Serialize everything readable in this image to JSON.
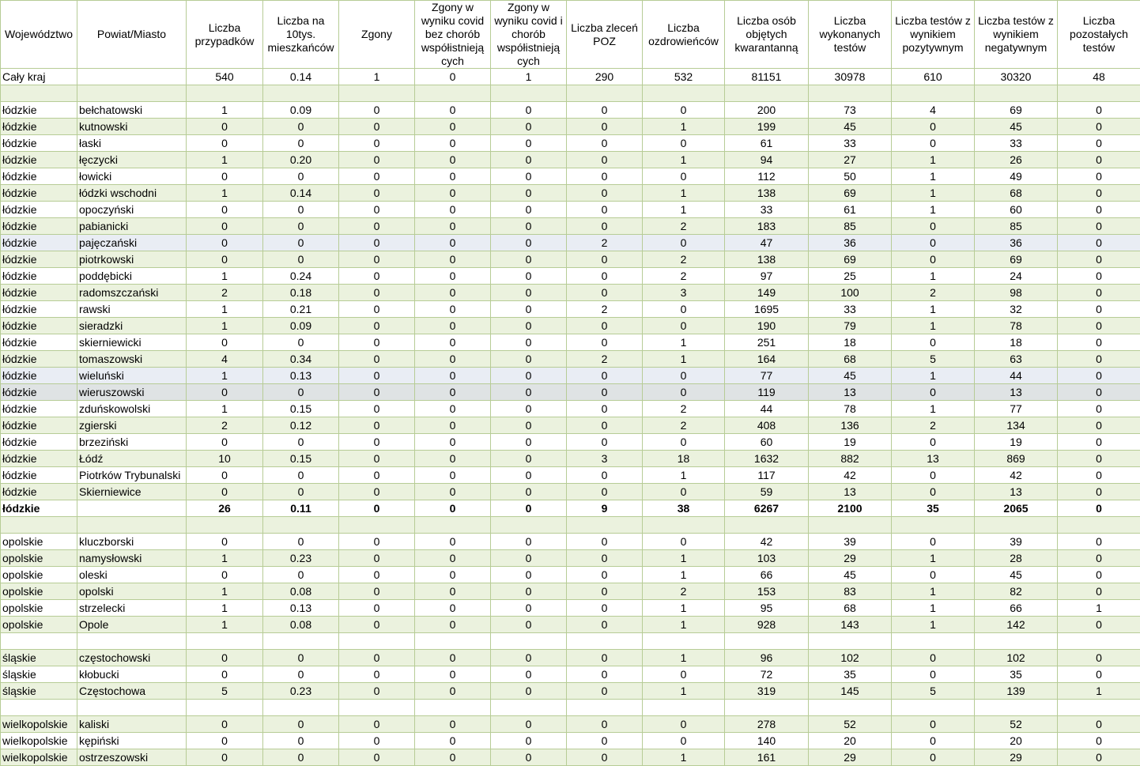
{
  "columns": [
    "Województwo",
    "Powiat/Miasto",
    "Liczba przypadków",
    "Liczba na 10tys. mieszkańców",
    "Zgony",
    "Zgony w wyniku covid bez chorób współistnieją cych",
    "Zgony w wyniku covid i chorób współistnieją cych",
    "Liczba zleceń POZ",
    "Liczba ozdrowieńców",
    "Liczba osób objętych kwarantanną",
    "Liczba wykonanych testów",
    "Liczba testów z wynikiem pozytywnym",
    "Liczba testów z wynikiem negatywnym",
    "Liczba pozostałych testów"
  ],
  "rows": [
    {
      "cells": [
        "Cały kraj",
        "",
        "540",
        "0.14",
        "1",
        "0",
        "1",
        "290",
        "532",
        "81151",
        "30978",
        "610",
        "30320",
        "48"
      ]
    },
    {
      "cells": [
        "",
        "",
        "",
        "",
        "",
        "",
        "",
        "",
        "",
        "",
        "",
        "",
        "",
        ""
      ]
    },
    {
      "cells": [
        "łódzkie",
        "bełchatowski",
        "1",
        "0.09",
        "0",
        "0",
        "0",
        "0",
        "0",
        "200",
        "73",
        "4",
        "69",
        "0"
      ]
    },
    {
      "cells": [
        "łódzkie",
        "kutnowski",
        "0",
        "0",
        "0",
        "0",
        "0",
        "0",
        "1",
        "199",
        "45",
        "0",
        "45",
        "0"
      ]
    },
    {
      "cells": [
        "łódzkie",
        "łaski",
        "0",
        "0",
        "0",
        "0",
        "0",
        "0",
        "0",
        "61",
        "33",
        "0",
        "33",
        "0"
      ]
    },
    {
      "cells": [
        "łódzkie",
        "łęczycki",
        "1",
        "0.20",
        "0",
        "0",
        "0",
        "0",
        "1",
        "94",
        "27",
        "1",
        "26",
        "0"
      ]
    },
    {
      "cells": [
        "łódzkie",
        "łowicki",
        "0",
        "0",
        "0",
        "0",
        "0",
        "0",
        "0",
        "112",
        "50",
        "1",
        "49",
        "0"
      ]
    },
    {
      "cells": [
        "łódzkie",
        "łódzki wschodni",
        "1",
        "0.14",
        "0",
        "0",
        "0",
        "0",
        "1",
        "138",
        "69",
        "1",
        "68",
        "0"
      ]
    },
    {
      "cells": [
        "łódzkie",
        "opoczyński",
        "0",
        "0",
        "0",
        "0",
        "0",
        "0",
        "1",
        "33",
        "61",
        "1",
        "60",
        "0"
      ]
    },
    {
      "cells": [
        "łódzkie",
        "pabianicki",
        "0",
        "0",
        "0",
        "0",
        "0",
        "0",
        "2",
        "183",
        "85",
        "0",
        "85",
        "0"
      ]
    },
    {
      "cells": [
        "łódzkie",
        "pajęczański",
        "0",
        "0",
        "0",
        "0",
        "0",
        "2",
        "0",
        "47",
        "36",
        "0",
        "36",
        "0"
      ]
    },
    {
      "cells": [
        "łódzkie",
        "piotrkowski",
        "0",
        "0",
        "0",
        "0",
        "0",
        "0",
        "2",
        "138",
        "69",
        "0",
        "69",
        "0"
      ]
    },
    {
      "cells": [
        "łódzkie",
        "poddębicki",
        "1",
        "0.24",
        "0",
        "0",
        "0",
        "0",
        "2",
        "97",
        "25",
        "1",
        "24",
        "0"
      ]
    },
    {
      "cells": [
        "łódzkie",
        "radomszczański",
        "2",
        "0.18",
        "0",
        "0",
        "0",
        "0",
        "3",
        "149",
        "100",
        "2",
        "98",
        "0"
      ]
    },
    {
      "cells": [
        "łódzkie",
        "rawski",
        "1",
        "0.21",
        "0",
        "0",
        "0",
        "2",
        "0",
        "1695",
        "33",
        "1",
        "32",
        "0"
      ]
    },
    {
      "cells": [
        "łódzkie",
        "sieradzki",
        "1",
        "0.09",
        "0",
        "0",
        "0",
        "0",
        "0",
        "190",
        "79",
        "1",
        "78",
        "0"
      ]
    },
    {
      "cells": [
        "łódzkie",
        "skierniewicki",
        "0",
        "0",
        "0",
        "0",
        "0",
        "0",
        "1",
        "251",
        "18",
        "0",
        "18",
        "0"
      ]
    },
    {
      "cells": [
        "łódzkie",
        "tomaszowski",
        "4",
        "0.34",
        "0",
        "0",
        "0",
        "2",
        "1",
        "164",
        "68",
        "5",
        "63",
        "0"
      ]
    },
    {
      "cells": [
        "łódzkie",
        "wieluński",
        "1",
        "0.13",
        "0",
        "0",
        "0",
        "0",
        "0",
        "77",
        "45",
        "1",
        "44",
        "0"
      ]
    },
    {
      "cells": [
        "łódzkie",
        "wieruszowski",
        "0",
        "0",
        "0",
        "0",
        "0",
        "0",
        "0",
        "119",
        "13",
        "0",
        "13",
        "0"
      ]
    },
    {
      "cells": [
        "łódzkie",
        "zduńskowolski",
        "1",
        "0.15",
        "0",
        "0",
        "0",
        "0",
        "2",
        "44",
        "78",
        "1",
        "77",
        "0"
      ]
    },
    {
      "cells": [
        "łódzkie",
        "zgierski",
        "2",
        "0.12",
        "0",
        "0",
        "0",
        "0",
        "2",
        "408",
        "136",
        "2",
        "134",
        "0"
      ]
    },
    {
      "cells": [
        "łódzkie",
        "brzeziński",
        "0",
        "0",
        "0",
        "0",
        "0",
        "0",
        "0",
        "60",
        "19",
        "0",
        "19",
        "0"
      ]
    },
    {
      "cells": [
        "łódzkie",
        "Łódź",
        "10",
        "0.15",
        "0",
        "0",
        "0",
        "3",
        "18",
        "1632",
        "882",
        "13",
        "869",
        "0"
      ]
    },
    {
      "cells": [
        "łódzkie",
        "Piotrków Trybunalski",
        "0",
        "0",
        "0",
        "0",
        "0",
        "0",
        "1",
        "117",
        "42",
        "0",
        "42",
        "0"
      ]
    },
    {
      "cells": [
        "łódzkie",
        "Skierniewice",
        "0",
        "0",
        "0",
        "0",
        "0",
        "0",
        "0",
        "59",
        "13",
        "0",
        "13",
        "0"
      ]
    },
    {
      "cells": [
        "łódzkie",
        "",
        "26",
        "0.11",
        "0",
        "0",
        "0",
        "9",
        "38",
        "6267",
        "2100",
        "35",
        "2065",
        "0"
      ]
    },
    {
      "cells": [
        "",
        "",
        "",
        "",
        "",
        "",
        "",
        "",
        "",
        "",
        "",
        "",
        "",
        ""
      ]
    },
    {
      "cells": [
        "opolskie",
        "kluczborski",
        "0",
        "0",
        "0",
        "0",
        "0",
        "0",
        "0",
        "42",
        "39",
        "0",
        "39",
        "0"
      ]
    },
    {
      "cells": [
        "opolskie",
        "namysłowski",
        "1",
        "0.23",
        "0",
        "0",
        "0",
        "0",
        "1",
        "103",
        "29",
        "1",
        "28",
        "0"
      ]
    },
    {
      "cells": [
        "opolskie",
        "oleski",
        "0",
        "0",
        "0",
        "0",
        "0",
        "0",
        "1",
        "66",
        "45",
        "0",
        "45",
        "0"
      ]
    },
    {
      "cells": [
        "opolskie",
        "opolski",
        "1",
        "0.08",
        "0",
        "0",
        "0",
        "0",
        "2",
        "153",
        "83",
        "1",
        "82",
        "0"
      ]
    },
    {
      "cells": [
        "opolskie",
        "strzelecki",
        "1",
        "0.13",
        "0",
        "0",
        "0",
        "0",
        "1",
        "95",
        "68",
        "1",
        "66",
        "1"
      ]
    },
    {
      "cells": [
        "opolskie",
        "Opole",
        "1",
        "0.08",
        "0",
        "0",
        "0",
        "0",
        "1",
        "928",
        "143",
        "1",
        "142",
        "0"
      ]
    },
    {
      "cells": [
        "",
        "",
        "",
        "",
        "",
        "",
        "",
        "",
        "",
        "",
        "",
        "",
        "",
        ""
      ]
    },
    {
      "cells": [
        "śląskie",
        "częstochowski",
        "0",
        "0",
        "0",
        "0",
        "0",
        "0",
        "1",
        "96",
        "102",
        "0",
        "102",
        "0"
      ]
    },
    {
      "cells": [
        "śląskie",
        "kłobucki",
        "0",
        "0",
        "0",
        "0",
        "0",
        "0",
        "0",
        "72",
        "35",
        "0",
        "35",
        "0"
      ]
    },
    {
      "cells": [
        "śląskie",
        "Częstochowa",
        "5",
        "0.23",
        "0",
        "0",
        "0",
        "0",
        "1",
        "319",
        "145",
        "5",
        "139",
        "1"
      ]
    },
    {
      "cells": [
        "",
        "",
        "",
        "",
        "",
        "",
        "",
        "",
        "",
        "",
        "",
        "",
        "",
        ""
      ]
    },
    {
      "cells": [
        "wielkopolskie",
        "kaliski",
        "0",
        "0",
        "0",
        "0",
        "0",
        "0",
        "0",
        "278",
        "52",
        "0",
        "52",
        "0"
      ]
    },
    {
      "cells": [
        "wielkopolskie",
        "kępiński",
        "0",
        "0",
        "0",
        "0",
        "0",
        "0",
        "0",
        "140",
        "20",
        "0",
        "20",
        "0"
      ]
    },
    {
      "cells": [
        "wielkopolskie",
        "ostrzeszowski",
        "0",
        "0",
        "0",
        "0",
        "0",
        "0",
        "1",
        "161",
        "29",
        "0",
        "29",
        "0"
      ]
    }
  ]
}
